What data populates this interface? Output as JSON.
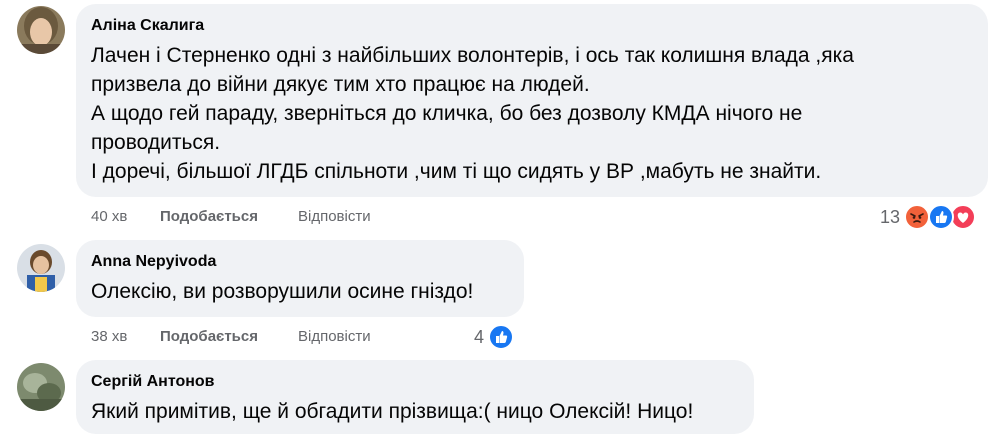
{
  "comments": [
    {
      "author": "Аліна Скалига",
      "lines": [
        "Лачен і Стерненко одні з найбільших волонтерів, і ось так колишня влада ,яка",
        "призвела до війни дякує тим хто працює на людей.",
        "А щодо гей параду, зверніться до кличка, бо без дозволу КМДА нічого не",
        "проводиться.",
        "І доречі, більшої ЛГДБ спільноти ,чим ті що сидять у ВР ,мабуть не знайти."
      ],
      "time": "40 хв",
      "like_label": "Подобається",
      "reply_label": "Відповісти",
      "reaction_count": "13",
      "reactions": [
        "angry-icon",
        "like-icon",
        "love-icon"
      ]
    },
    {
      "author": "Anna Nepyivoda",
      "lines": [
        "Олексію, ви розворушили осине гніздо!"
      ],
      "time": "38 хв",
      "like_label": "Подобається",
      "reply_label": "Відповісти",
      "reaction_count": "4",
      "reactions": [
        "like-icon"
      ]
    },
    {
      "author": "Сергій Антонов",
      "lines": [
        "Який примітив, ще й обгадити прізвища:( ницо Олексій! Ницо!"
      ]
    }
  ],
  "colors": {
    "bubble": "#f0f2f5",
    "meta_text": "#65676b",
    "like_blue": "#1877f2",
    "love_red": "#f33e58",
    "angry_orange": "#f2613a"
  }
}
